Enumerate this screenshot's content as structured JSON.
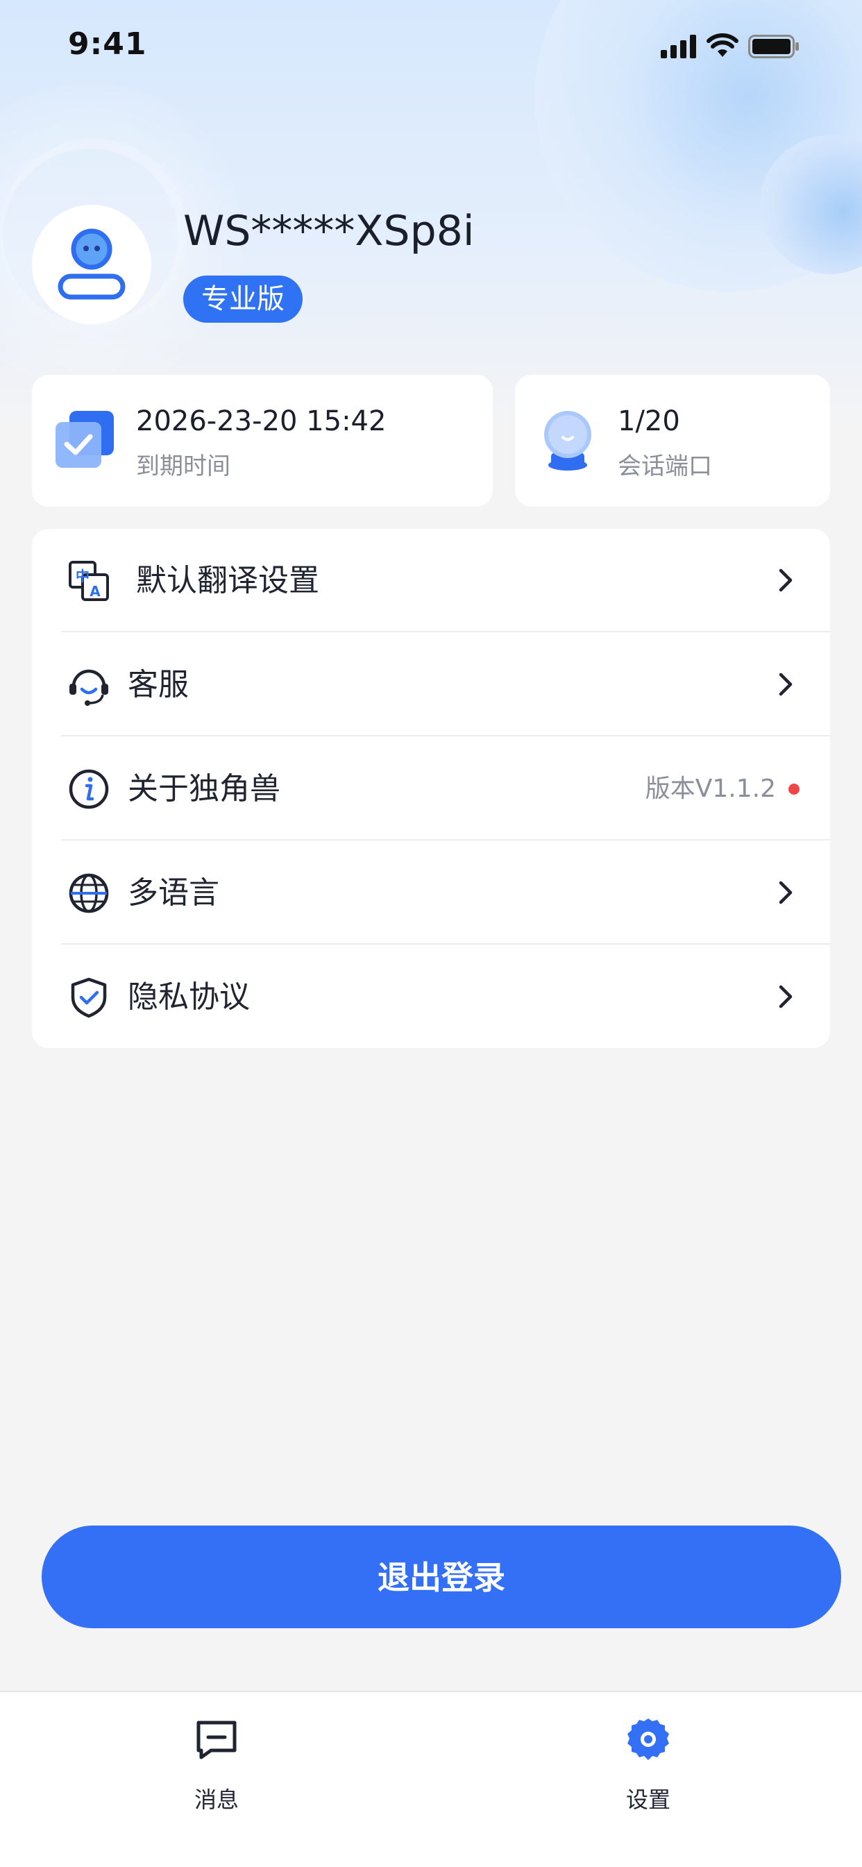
{
  "status_bar": {
    "time": "9:41",
    "icons": [
      "signal-icon",
      "wifi-icon",
      "battery-icon"
    ]
  },
  "profile": {
    "username": "WS*****XSp8i",
    "plan_badge": "专业版",
    "avatar_icon": "user-avatar-icon"
  },
  "stats": {
    "expiry": {
      "value": "2026-23-20 15:42",
      "label": "到期时间",
      "icon": "calendar-check-icon"
    },
    "session": {
      "value": "1/20",
      "label": "会话端口",
      "icon": "session-port-icon"
    }
  },
  "menu": {
    "items": [
      {
        "label": "默认翻译设置",
        "icon": "translate-icon"
      },
      {
        "label": "客服",
        "icon": "headset-icon"
      },
      {
        "label": "关于独角兽",
        "icon": "info-icon",
        "version": "版本V1.1.2"
      },
      {
        "label": "多语言",
        "icon": "globe-icon"
      },
      {
        "label": "隐私协议",
        "icon": "shield-check-icon"
      }
    ]
  },
  "logout_label": "退出登录",
  "tabbar": {
    "tabs": [
      {
        "label": "消息",
        "icon": "message-icon"
      },
      {
        "label": "设置",
        "icon": "settings-gear-icon"
      }
    ]
  },
  "colors": {
    "accent": "#3370f6",
    "badge": "#2f72f3",
    "dot": "#f04646",
    "background": "#f4f4f5"
  }
}
